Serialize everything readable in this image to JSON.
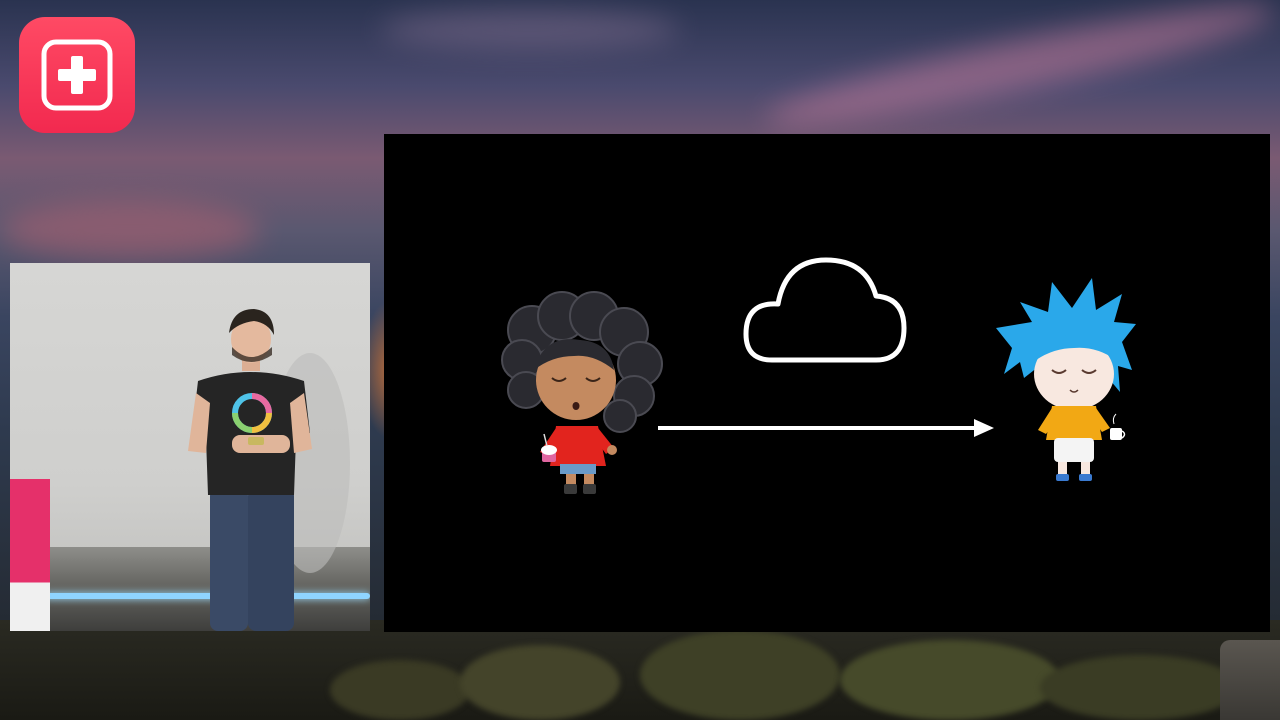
{
  "app": {
    "brand_icon": "first-aid-cross-icon",
    "brand_color": "#f2294f"
  },
  "camera_feed": {
    "shirt_graphic": "color-ring-icon"
  },
  "slide": {
    "background": "#000000",
    "elements": {
      "cloud": "cloud-icon",
      "arrow": "right-arrow-icon",
      "sender": "curly-hair-character",
      "receiver": "blue-hair-character"
    }
  }
}
